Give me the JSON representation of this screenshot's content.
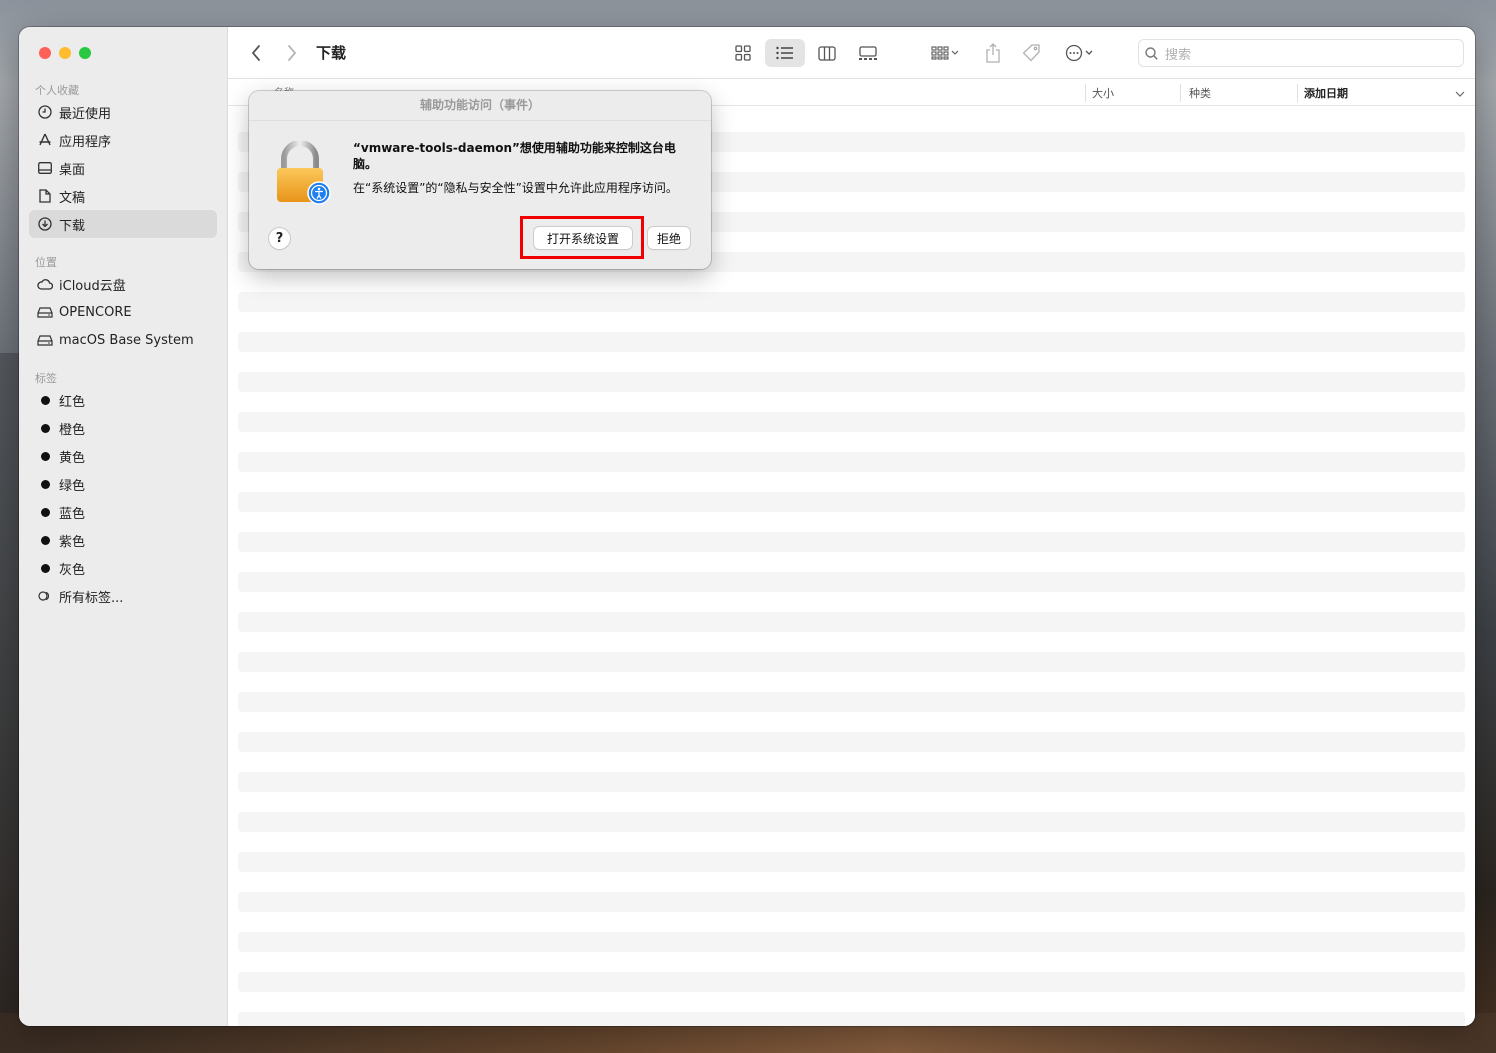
{
  "window": {
    "title": "下载",
    "traffic_colors": [
      "#fe5f57",
      "#febc2e",
      "#28c840"
    ]
  },
  "sidebar": {
    "favorites_title": "个人收藏",
    "favorites": [
      {
        "label": "最近使用",
        "icon": "clock-icon"
      },
      {
        "label": "应用程序",
        "icon": "apps-icon"
      },
      {
        "label": "桌面",
        "icon": "desktop-icon"
      },
      {
        "label": "文稿",
        "icon": "document-icon"
      },
      {
        "label": "下载",
        "icon": "download-icon",
        "selected": true
      }
    ],
    "locations_title": "位置",
    "locations": [
      {
        "label": "iCloud云盘",
        "icon": "cloud-icon"
      },
      {
        "label": "OPENCORE",
        "icon": "drive-icon"
      },
      {
        "label": "macOS Base System",
        "icon": "drive-icon"
      }
    ],
    "tags_title": "标签",
    "tags": [
      {
        "label": "红色"
      },
      {
        "label": "橙色"
      },
      {
        "label": "黄色"
      },
      {
        "label": "绿色"
      },
      {
        "label": "蓝色"
      },
      {
        "label": "紫色"
      },
      {
        "label": "灰色"
      }
    ],
    "all_tags": "所有标签..."
  },
  "toolbar": {
    "search_placeholder": "搜索"
  },
  "columns": {
    "name": "名称",
    "size": "大小",
    "kind": "种类",
    "date_added": "添加日期"
  },
  "dialog": {
    "title": "辅助功能访问（事件）",
    "message": "“vmware-tools-daemon”想使用辅助功能来控制这台电脑。",
    "info": "在“系统设置”的“隐私与安全性”设置中允许此应用程序访问。",
    "help": "?",
    "open_settings": "打开系统设置",
    "deny": "拒绝"
  }
}
